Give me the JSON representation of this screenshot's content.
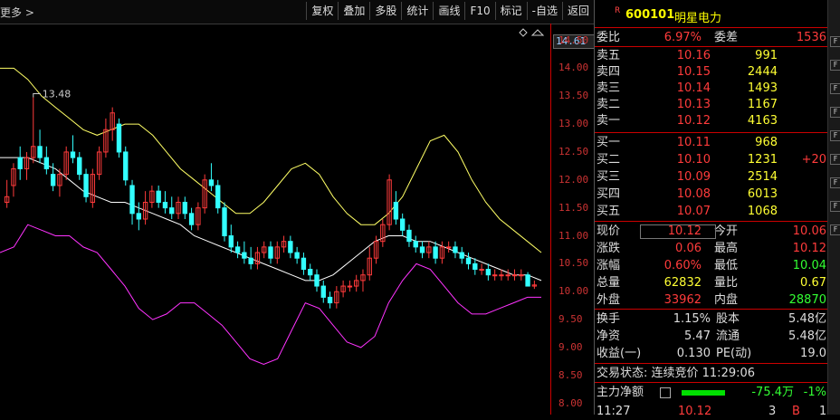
{
  "toolbar": {
    "more_label": "更多 >",
    "buttons": [
      "复权",
      "叠加",
      "多股",
      "统计",
      "画线",
      "F10",
      "标记",
      "-自选",
      "返回"
    ]
  },
  "chart": {
    "high_label": "13.48",
    "axis_ticks": [
      "14.50",
      "14.00",
      "13.50",
      "13.00",
      "12.50",
      "12.00",
      "11.50",
      "11.00",
      "10.50",
      "10.00",
      "9.50",
      "9.00",
      "8.50",
      "8.00"
    ],
    "current_price_tag": "14.61",
    "colors": {
      "up": "#ff3b3b",
      "down": "#33ffff",
      "upper_band": "#ffff66",
      "middle_band": "#ffffff",
      "lower_band": "#ff33ff"
    }
  },
  "chart_data": {
    "type": "candlestick",
    "ylim": [
      7.8,
      14.8
    ],
    "candles": [
      [
        11.6,
        12.0,
        11.5,
        11.7
      ],
      [
        11.9,
        12.3,
        11.7,
        12.2
      ],
      [
        12.4,
        12.6,
        12.0,
        12.2
      ],
      [
        12.2,
        12.5,
        12.0,
        12.4
      ],
      [
        12.4,
        13.48,
        12.3,
        12.6
      ],
      [
        12.6,
        12.9,
        12.3,
        12.4
      ],
      [
        12.4,
        12.6,
        12.1,
        12.2
      ],
      [
        12.1,
        12.3,
        11.8,
        11.9
      ],
      [
        11.9,
        12.2,
        11.7,
        12.1
      ],
      [
        12.1,
        12.6,
        12.0,
        12.5
      ],
      [
        12.5,
        12.8,
        12.3,
        12.4
      ],
      [
        12.4,
        12.5,
        12.0,
        12.1
      ],
      [
        12.1,
        12.2,
        11.6,
        11.7
      ],
      [
        11.6,
        12.2,
        11.5,
        12.1
      ],
      [
        12.1,
        12.6,
        12.0,
        12.5
      ],
      [
        12.5,
        13.1,
        12.4,
        12.9
      ],
      [
        12.9,
        13.3,
        12.7,
        13.2
      ],
      [
        13.0,
        13.1,
        12.4,
        12.5
      ],
      [
        12.5,
        12.6,
        11.9,
        12.0
      ],
      [
        11.9,
        12.0,
        11.2,
        11.4
      ],
      [
        11.4,
        11.6,
        11.1,
        11.3
      ],
      [
        11.3,
        11.8,
        11.2,
        11.6
      ],
      [
        11.6,
        11.9,
        11.5,
        11.8
      ],
      [
        11.8,
        11.9,
        11.5,
        11.6
      ],
      [
        11.6,
        11.8,
        11.4,
        11.5
      ],
      [
        11.5,
        11.7,
        11.3,
        11.4
      ],
      [
        11.4,
        11.7,
        11.3,
        11.6
      ],
      [
        11.6,
        11.7,
        11.3,
        11.4
      ],
      [
        11.4,
        11.5,
        11.1,
        11.2
      ],
      [
        11.2,
        11.6,
        11.1,
        11.5
      ],
      [
        11.5,
        12.1,
        11.4,
        12.0
      ],
      [
        12.0,
        12.3,
        11.8,
        11.9
      ],
      [
        11.9,
        12.0,
        11.4,
        11.5
      ],
      [
        11.5,
        11.6,
        10.9,
        11.0
      ],
      [
        11.0,
        11.2,
        10.7,
        10.8
      ],
      [
        10.8,
        10.9,
        10.6,
        10.7
      ],
      [
        10.7,
        10.9,
        10.5,
        10.6
      ],
      [
        10.6,
        10.8,
        10.4,
        10.5
      ],
      [
        10.5,
        10.8,
        10.4,
        10.7
      ],
      [
        10.7,
        10.9,
        10.6,
        10.8
      ],
      [
        10.8,
        10.9,
        10.5,
        10.6
      ],
      [
        10.6,
        10.9,
        10.5,
        10.8
      ],
      [
        10.8,
        11.0,
        10.7,
        10.9
      ],
      [
        10.9,
        11.0,
        10.6,
        10.7
      ],
      [
        10.7,
        10.8,
        10.5,
        10.6
      ],
      [
        10.6,
        10.7,
        10.3,
        10.4
      ],
      [
        10.4,
        10.5,
        10.2,
        10.3
      ],
      [
        10.3,
        10.4,
        10.0,
        10.1
      ],
      [
        10.1,
        10.2,
        9.8,
        9.9
      ],
      [
        9.9,
        10.0,
        9.7,
        9.8
      ],
      [
        9.8,
        10.1,
        9.7,
        10.0
      ],
      [
        10.0,
        10.2,
        9.9,
        10.1
      ],
      [
        10.1,
        10.2,
        10.0,
        10.1
      ],
      [
        10.1,
        10.3,
        10.0,
        10.2
      ],
      [
        10.2,
        10.4,
        10.0,
        10.3
      ],
      [
        10.3,
        10.8,
        10.2,
        10.6
      ],
      [
        10.6,
        11.0,
        10.5,
        10.9
      ],
      [
        10.9,
        11.3,
        10.8,
        11.2
      ],
      [
        11.2,
        12.1,
        11.1,
        12.0
      ],
      [
        11.6,
        11.8,
        11.2,
        11.3
      ],
      [
        11.3,
        11.4,
        11.0,
        11.1
      ],
      [
        11.1,
        11.2,
        10.8,
        10.9
      ],
      [
        10.9,
        11.0,
        10.7,
        10.8
      ],
      [
        10.8,
        10.9,
        10.6,
        10.7
      ],
      [
        10.7,
        10.9,
        10.6,
        10.8
      ],
      [
        10.8,
        10.9,
        10.5,
        10.6
      ],
      [
        10.6,
        10.9,
        10.5,
        10.8
      ],
      [
        10.8,
        10.9,
        10.7,
        10.8
      ],
      [
        10.8,
        10.9,
        10.6,
        10.7
      ],
      [
        10.7,
        10.8,
        10.5,
        10.6
      ],
      [
        10.6,
        10.7,
        10.4,
        10.5
      ],
      [
        10.5,
        10.6,
        10.3,
        10.4
      ],
      [
        10.4,
        10.5,
        10.3,
        10.4
      ],
      [
        10.4,
        10.5,
        10.2,
        10.3
      ],
      [
        10.3,
        10.4,
        10.2,
        10.3
      ],
      [
        10.3,
        10.4,
        10.2,
        10.3
      ],
      [
        10.3,
        10.4,
        10.2,
        10.3
      ],
      [
        10.3,
        10.4,
        10.2,
        10.3
      ],
      [
        10.3,
        10.4,
        10.2,
        10.3
      ],
      [
        10.3,
        10.35,
        10.1,
        10.1
      ],
      [
        10.1,
        10.2,
        10.05,
        10.12
      ]
    ],
    "upper_band": [
      14.0,
      14.0,
      13.8,
      13.5,
      13.3,
      13.1,
      12.9,
      12.8,
      12.9,
      13.0,
      13.0,
      12.8,
      12.5,
      12.2,
      12.0,
      11.8,
      11.6,
      11.4,
      11.4,
      11.6,
      11.9,
      12.2,
      12.3,
      12.1,
      11.7,
      11.4,
      11.2,
      11.2,
      11.4,
      11.7,
      12.2,
      12.7,
      12.8,
      12.5,
      12.0,
      11.6,
      11.3,
      11.1,
      10.9,
      10.7
    ],
    "middle_band": [
      12.4,
      12.4,
      12.4,
      12.3,
      12.2,
      12.0,
      11.8,
      11.7,
      11.6,
      11.6,
      11.5,
      11.4,
      11.3,
      11.2,
      11.0,
      10.9,
      10.8,
      10.7,
      10.6,
      10.5,
      10.4,
      10.3,
      10.2,
      10.2,
      10.3,
      10.5,
      10.7,
      10.9,
      11.0,
      11.0,
      10.9,
      10.9,
      10.8,
      10.7,
      10.6,
      10.5,
      10.4,
      10.3,
      10.3,
      10.2
    ],
    "lower_band": [
      10.7,
      10.8,
      11.2,
      11.1,
      11.0,
      11.0,
      10.8,
      10.7,
      10.4,
      10.1,
      9.7,
      9.5,
      9.6,
      9.8,
      9.8,
      9.6,
      9.4,
      9.1,
      8.8,
      8.7,
      8.8,
      9.3,
      9.8,
      9.7,
      9.4,
      9.1,
      9.0,
      9.2,
      9.8,
      10.2,
      10.5,
      10.4,
      10.1,
      9.8,
      9.6,
      9.6,
      9.7,
      9.8,
      9.9,
      9.9
    ]
  },
  "panel": {
    "r_badge": "R",
    "code": "600101",
    "name": "明星电力",
    "weibi_label": "委比",
    "weibi_value": "6.97%",
    "weicha_label": "委差",
    "weicha_value": "1536",
    "asks": [
      {
        "label": "卖五",
        "price": "10.16",
        "vol": "991"
      },
      {
        "label": "卖四",
        "price": "10.15",
        "vol": "2444"
      },
      {
        "label": "卖三",
        "price": "10.14",
        "vol": "1493"
      },
      {
        "label": "卖二",
        "price": "10.13",
        "vol": "1167"
      },
      {
        "label": "卖一",
        "price": "10.12",
        "vol": "4163"
      }
    ],
    "bids": [
      {
        "label": "买一",
        "price": "10.11",
        "vol": "968"
      },
      {
        "label": "买二",
        "price": "10.10",
        "vol": "1231",
        "extra": "+20"
      },
      {
        "label": "买三",
        "price": "10.09",
        "vol": "2514"
      },
      {
        "label": "买四",
        "price": "10.08",
        "vol": "6013"
      },
      {
        "label": "买五",
        "price": "10.07",
        "vol": "1068"
      }
    ],
    "stats": [
      {
        "l1": "现价",
        "v1": "10.12",
        "l2": "今开",
        "v2": "10.06"
      },
      {
        "l1": "涨跌",
        "v1": "0.06",
        "l2": "最高",
        "v2": "10.12"
      },
      {
        "l1": "涨幅",
        "v1": "0.60%",
        "l2": "最低",
        "v2": "10.04"
      },
      {
        "l1": "总量",
        "v1": "62832",
        "l2": "量比",
        "v2": "0.67"
      },
      {
        "l1": "外盘",
        "v1": "33962",
        "l2": "内盘",
        "v2": "28870"
      }
    ],
    "stats2": [
      {
        "l1": "换手",
        "v1": "1.15%",
        "l2": "股本",
        "v2": "5.48亿"
      },
      {
        "l1": "净资",
        "v1": "5.47",
        "l2": "流通",
        "v2": "5.48亿"
      },
      {
        "l1": "收益(一)",
        "v1": "0.130",
        "l2": "PE(动)",
        "v2": "19.0"
      }
    ],
    "trade_status": "交易状态: 连续竞价 11:29:06",
    "main_flow_label": "主力净额",
    "main_flow_value": "-75.4万",
    "main_flow_pct": "-1%",
    "last_row": {
      "time": "11:27",
      "price": "10.12",
      "vol": "3",
      "flag": "B",
      "n": "1"
    }
  },
  "side_icons": [
    "F",
    "F",
    "F",
    "F",
    "F",
    "F",
    "F",
    "F",
    "F"
  ]
}
